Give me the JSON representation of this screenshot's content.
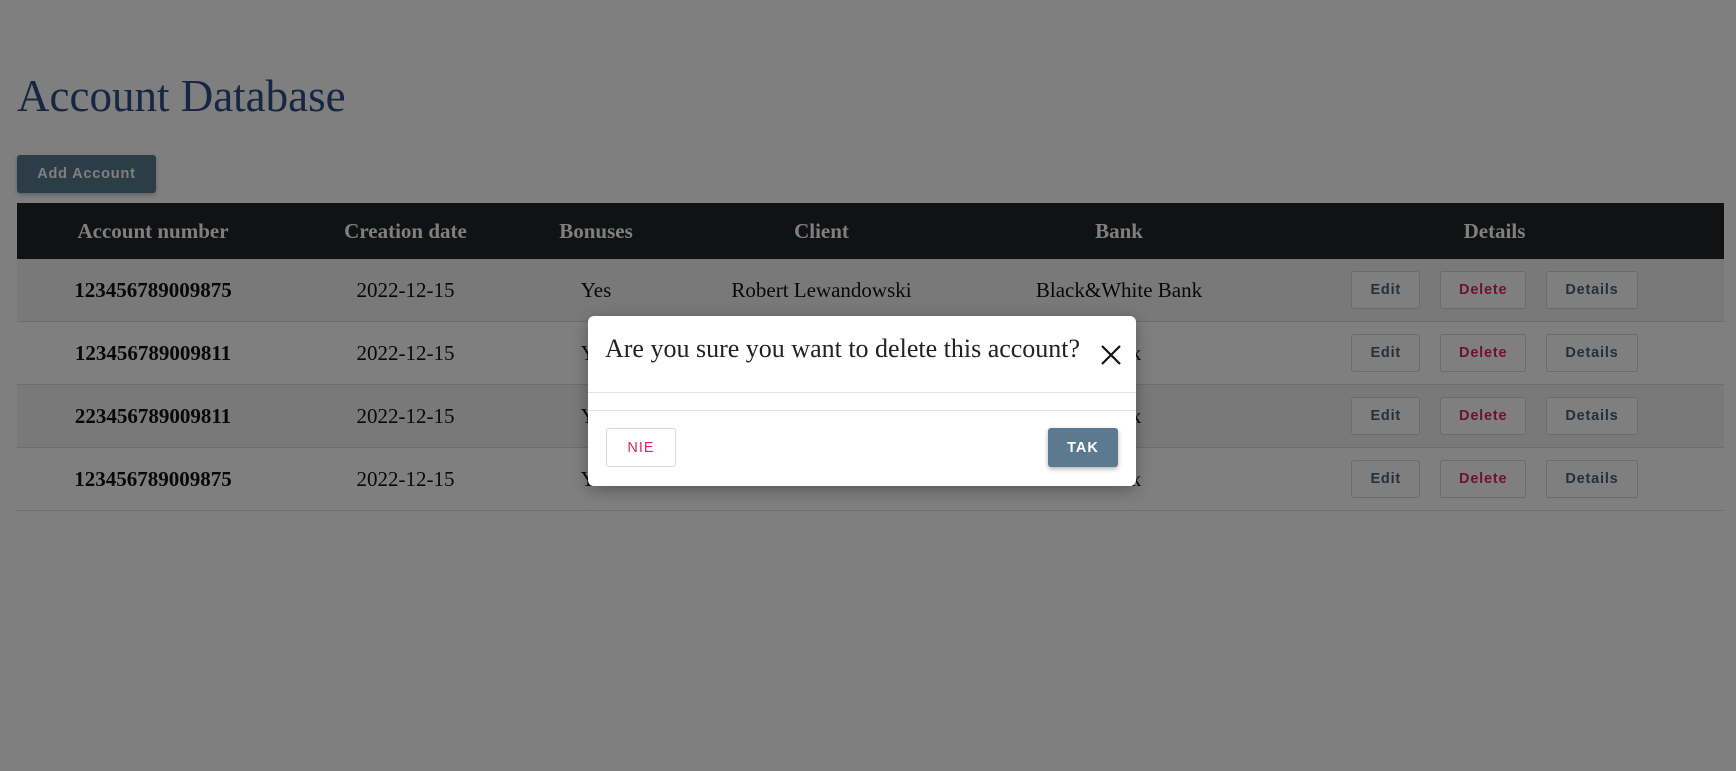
{
  "page": {
    "title": "Account Database",
    "add_button_label": "Add Account"
  },
  "table": {
    "headers": [
      "Account number",
      "Creation date",
      "Bonuses",
      "Client",
      "Bank",
      "Details"
    ],
    "rows": [
      {
        "account_number": "123456789009875",
        "creation_date": "2022-12-15",
        "bonuses": "Yes",
        "client": "Robert Lewandowski",
        "bank": "Black&White Bank"
      },
      {
        "account_number": "123456789009811",
        "creation_date": "2022-12-15",
        "bonuses": "Yes",
        "client": "",
        "bank": "Bank"
      },
      {
        "account_number": "223456789009811",
        "creation_date": "2022-12-15",
        "bonuses": "Yes",
        "client": "",
        "bank": "Bank"
      },
      {
        "account_number": "123456789009875",
        "creation_date": "2022-12-15",
        "bonuses": "Yes",
        "client": "",
        "bank": "Bank"
      }
    ],
    "action_labels": {
      "edit": "Edit",
      "delete": "Delete",
      "details": "Details"
    }
  },
  "modal": {
    "title": "Are you sure you want to delete this account?",
    "cancel_label": "NIE",
    "confirm_label": "TAK",
    "close_icon": "close-icon"
  },
  "colors": {
    "primary_button": "#5b7a8f",
    "danger_text": "#e0245e",
    "table_header_bg": "#212429",
    "title_color": "#2f4f86",
    "overlay": "rgba(0,0,0,0.5)"
  }
}
